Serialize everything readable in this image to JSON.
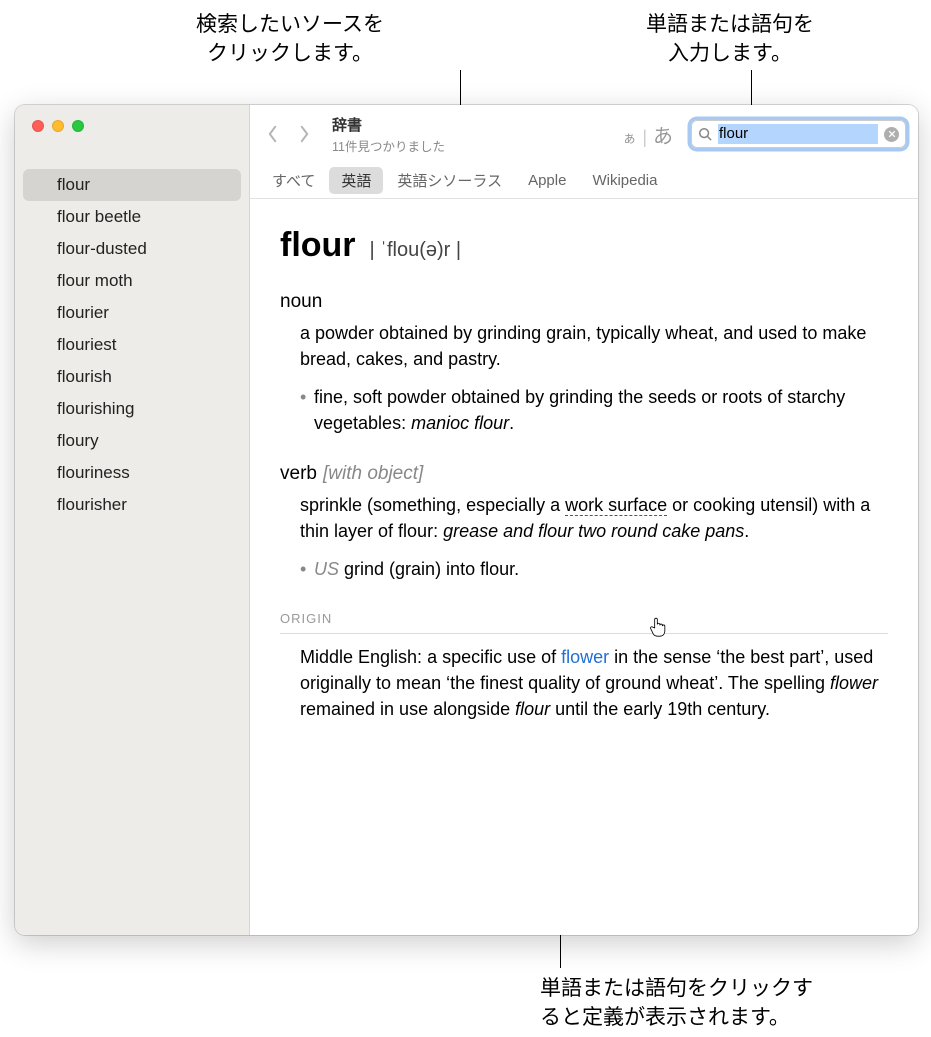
{
  "callouts": {
    "source": {
      "line1": "検索したいソースを",
      "line2": "クリックします。"
    },
    "input": {
      "line1": "単語または語句を",
      "line2": "入力します。"
    },
    "lookup": {
      "line1": "単語または語句をクリックす",
      "line2": "ると定義が表示されます。"
    }
  },
  "window": {
    "title": "辞書",
    "subtitle": "11件見つかりました"
  },
  "fontsize": {
    "small": "ぁ",
    "big": "あ"
  },
  "search": {
    "value": "flour"
  },
  "tabs": [
    "すべて",
    "英語",
    "英語シソーラス",
    "Apple",
    "Wikipedia"
  ],
  "selected_tab_index": 1,
  "sidebar_words": [
    "flour",
    "flour beetle",
    "flour-dusted",
    "flour moth",
    "flourier",
    "flouriest",
    "flourish",
    "flourishing",
    "floury",
    "flouriness",
    "flourisher"
  ],
  "selected_word_index": 0,
  "entry": {
    "headword": "flour",
    "pronunciation": "| ˈflou(ə)r |",
    "noun": {
      "label": "noun",
      "def": "a powder obtained by grinding grain, typically wheat, and used to make bread, cakes, and pastry.",
      "sub_pre": "fine, soft powder obtained by grinding the seeds or roots of starchy vegetables: ",
      "sub_ex": "manioc flour",
      "sub_post": "."
    },
    "verb": {
      "label": "verb",
      "note": "[with object]",
      "def_pre": "sprinkle (something, especially a ",
      "def_lookup": "work surface",
      "def_mid": " or cooking utensil) with a thin layer of flour: ",
      "def_ex": "grease and flour two round cake pans",
      "def_post": ".",
      "sub_region": "US",
      "sub_text": " grind (grain) into flour."
    },
    "origin": {
      "header": "ORIGIN",
      "t1": "Middle English: a specific use of ",
      "link": "flower",
      "t2": " in the sense ‘the best part’, used originally to mean ‘the finest quality of ground wheat’. The spelling ",
      "ital1": "flower",
      "t3": " remained in use alongside ",
      "ital2": "flour",
      "t4": " until the early 19th century."
    }
  }
}
